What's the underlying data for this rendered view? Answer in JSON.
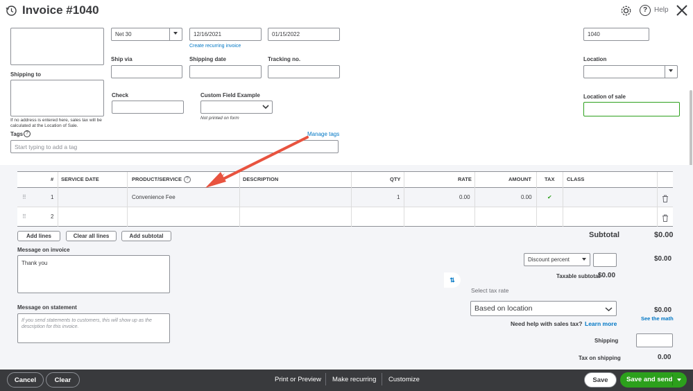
{
  "header": {
    "title": "Invoice #1040",
    "help_label": "Help"
  },
  "form": {
    "terms": "Net 30",
    "invoice_date": "12/16/2021",
    "due_date": "01/15/2022",
    "create_recurring": "Create recurring invoice",
    "invoice_no": "1040",
    "ship_via_label": "Ship via",
    "shipping_date_label": "Shipping date",
    "tracking_label": "Tracking no.",
    "location_label": "Location",
    "shipping_to_label": "Shipping to",
    "check_label": "Check",
    "custom_field_label": "Custom Field Example",
    "not_printed": "Not printed on form",
    "location_of_sale_label": "Location of sale",
    "address_note": "If no address is entered here, sales tax will be calculated at the Location of Sale.",
    "tags_label": "Tags",
    "manage_tags": "Manage tags",
    "tags_placeholder": "Start typing to add a tag"
  },
  "table": {
    "headers": {
      "num": "#",
      "service_date": "SERVICE DATE",
      "product": "PRODUCT/SERVICE",
      "description": "DESCRIPTION",
      "qty": "QTY",
      "rate": "RATE",
      "amount": "AMOUNT",
      "tax": "TAX",
      "class": "CLASS"
    },
    "rows": [
      {
        "num": "1",
        "product": "Convenience Fee",
        "qty": "1",
        "rate": "0.00",
        "amount": "0.00",
        "tax": "✔"
      },
      {
        "num": "2"
      }
    ]
  },
  "actions": {
    "add_lines": "Add lines",
    "clear_all_lines": "Clear all lines",
    "add_subtotal": "Add subtotal"
  },
  "message_invoice": {
    "label": "Message on invoice",
    "value": "Thank you"
  },
  "message_statement": {
    "label": "Message on statement",
    "placeholder": "If you send statements to customers, this will show up as the description for this invoice."
  },
  "totals": {
    "subtotal_label": "Subtotal",
    "subtotal": "$0.00",
    "discount_type": "Discount percent",
    "discount_amount": "$0.00",
    "taxable_subtotal_label": "Taxable subtotal",
    "taxable_subtotal": "$0.00",
    "select_tax_rate": "Select tax rate",
    "tax_rate": "Based on location",
    "tax_amount": "$0.00",
    "see_math": "See the math",
    "need_help": "Need help with sales tax?",
    "learn_more": "Learn more",
    "shipping_label": "Shipping",
    "tax_on_shipping_label": "Tax on shipping",
    "tax_on_shipping": "0.00"
  },
  "footer": {
    "cancel": "Cancel",
    "clear": "Clear",
    "print_preview": "Print or Preview",
    "make_recurring": "Make recurring",
    "customize": "Customize",
    "save": "Save",
    "save_and_send": "Save and send"
  },
  "colors": {
    "accent_green": "#2ca01c",
    "link_blue": "#0077c5",
    "footer_bg": "#393a3d",
    "arrow_red": "#e8533f"
  }
}
